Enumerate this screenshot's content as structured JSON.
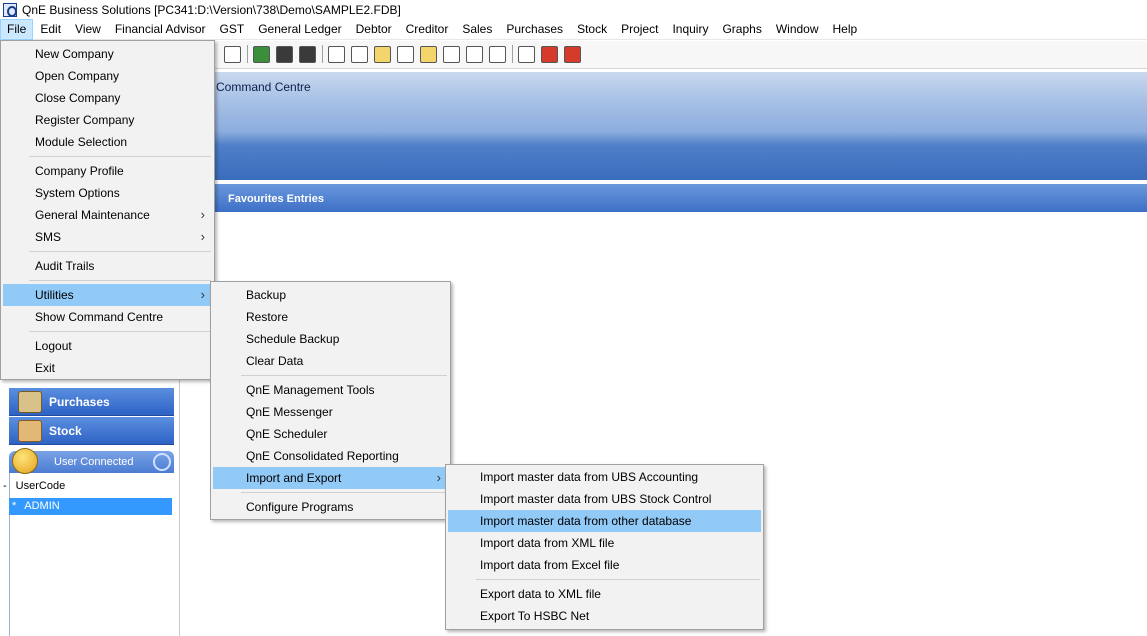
{
  "window": {
    "title": "QnE Business Solutions [PC341:D:\\Version\\738\\Demo\\SAMPLE2.FDB]"
  },
  "menubar": [
    "File",
    "Edit",
    "View",
    "Financial Advisor",
    "GST",
    "General Ledger",
    "Debtor",
    "Creditor",
    "Sales",
    "Purchases",
    "Stock",
    "Project",
    "Inquiry",
    "Graphs",
    "Window",
    "Help"
  ],
  "command_centre": {
    "title": "Command Centre",
    "favourites": "Favourites Entries"
  },
  "left_panel": {
    "purchases": "Purchases",
    "stock": "Stock",
    "user_connected": "User Connected",
    "usercode_header": "UserCode",
    "usercode_marker": "-",
    "selected_user": "ADMIN",
    "selected_marker": "*"
  },
  "file_menu": {
    "new_company": "New Company",
    "open_company": "Open Company",
    "close_company": "Close Company",
    "register_company": "Register Company",
    "module_selection": "Module Selection",
    "company_profile": "Company Profile",
    "system_options": "System Options",
    "general_maintenance": "General Maintenance",
    "sms": "SMS",
    "audit_trails": "Audit Trails",
    "utilities": "Utilities",
    "show_command_centre": "Show Command Centre",
    "logout": "Logout",
    "exit": "Exit",
    "submenu_arrow": "›"
  },
  "utilities_menu": {
    "backup": "Backup",
    "restore": "Restore",
    "schedule_backup": "Schedule Backup",
    "clear_data": "Clear Data",
    "management_tools": "QnE Management Tools",
    "messenger": "QnE Messenger",
    "scheduler": "QnE Scheduler",
    "consolidated_reporting": "QnE Consolidated Reporting",
    "import_export": "Import and Export",
    "configure_programs": "Configure Programs"
  },
  "import_export_menu": {
    "ubs_accounting": "Import master data from UBS Accounting",
    "ubs_stock": "Import master data from UBS Stock Control",
    "other_database": "Import master data from other database",
    "xml_import": "Import data from XML file",
    "excel_import": "Import data from Excel file",
    "xml_export": "Export data to XML file",
    "hsbc": "Export To HSBC Net"
  }
}
